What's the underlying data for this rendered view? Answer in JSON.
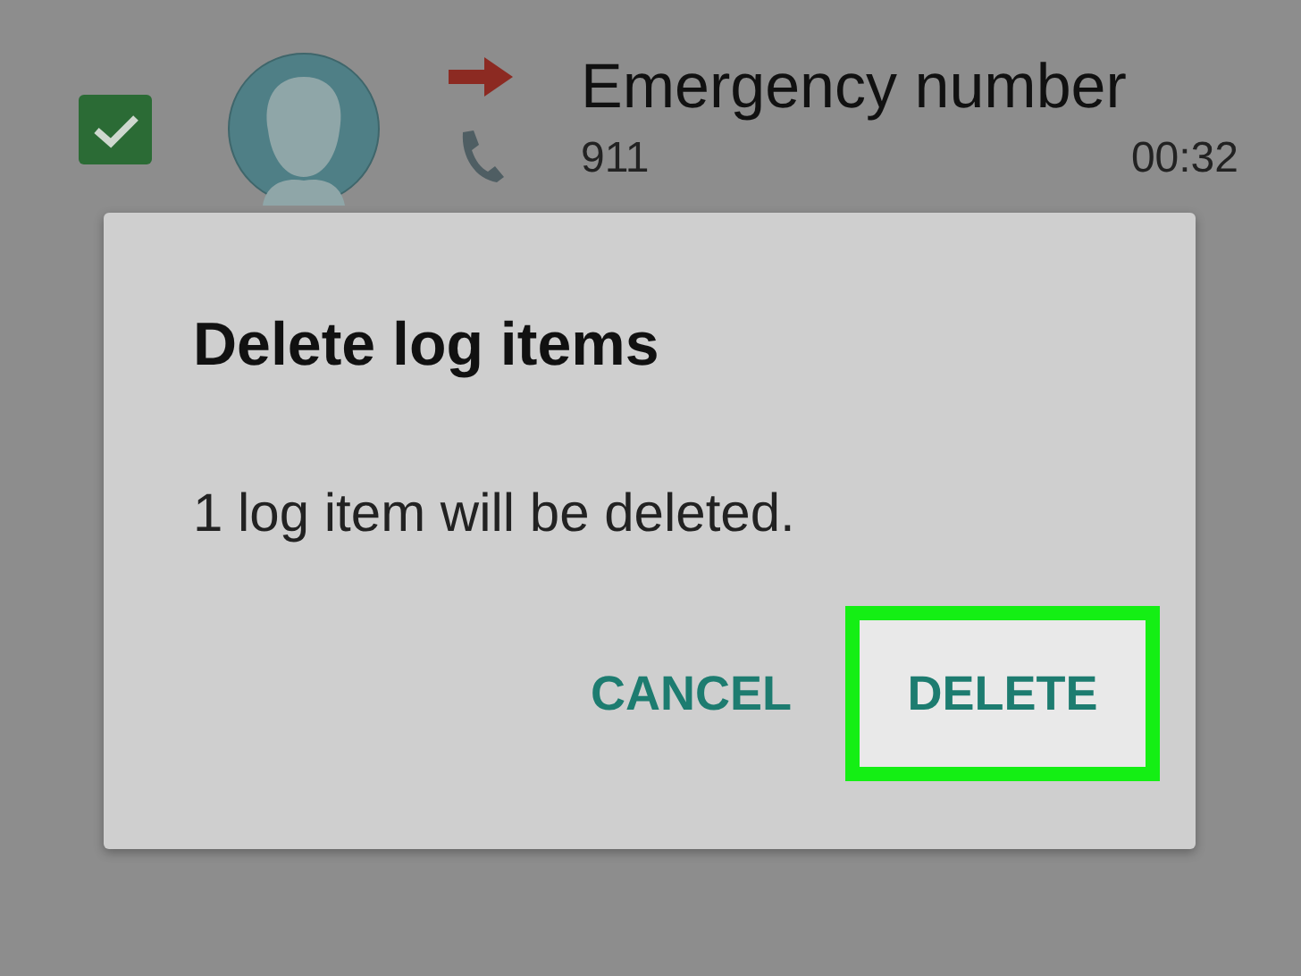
{
  "call_log_item": {
    "checked": true,
    "name": "Emergency number",
    "number": "911",
    "duration": "00:32"
  },
  "dialog": {
    "title": "Delete log items",
    "message": "1 log item will be deleted.",
    "buttons": [
      {
        "label": "CANCEL",
        "highlighted": false
      },
      {
        "label": "DELETE",
        "highlighted": true
      }
    ]
  }
}
